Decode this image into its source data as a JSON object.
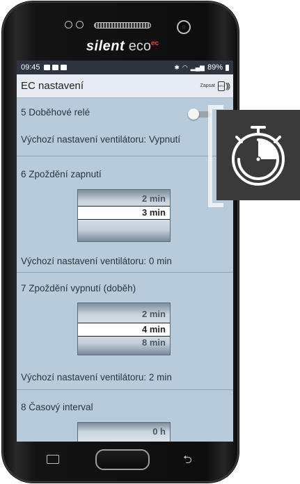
{
  "device": {
    "brand_primary": "silent",
    "brand_secondary": "eco",
    "brand_sup": "ec"
  },
  "statusbar": {
    "time": "09:45",
    "battery": "89%"
  },
  "appbar": {
    "title": "EC nastavení",
    "write_label": "Zapsat",
    "nfc_label": "NFC"
  },
  "sections": [
    {
      "number": "5",
      "title": "Doběhové relé",
      "control": "toggle",
      "toggle_on": false,
      "default_text": "Výchozí nastavení ventilátoru: Vypnutí"
    },
    {
      "number": "6",
      "title": "Zpoždění zapnutí",
      "control": "picker",
      "above": "2 min",
      "selected": "3 min",
      "below": "",
      "default_text": "Výchozí nastavení ventilátoru: 0 min"
    },
    {
      "number": "7",
      "title": "Zpoždění vypnutí (doběh)",
      "control": "picker",
      "above": "2 min",
      "selected": "4 min",
      "below": "8 min",
      "default_text": "Výchozí nastavení ventilátoru: 2 min"
    },
    {
      "number": "8",
      "title": "Časový interval",
      "control": "picker",
      "above": "0 h"
    }
  ],
  "colors": {
    "screen_bg": "#b7cbdb",
    "statusbar_bg": "#2e3540",
    "appbar_bg": "#e6ecf1",
    "overlay_tile": "#3a3a3a"
  },
  "icons": {
    "overlay": "stopwatch-icon"
  }
}
